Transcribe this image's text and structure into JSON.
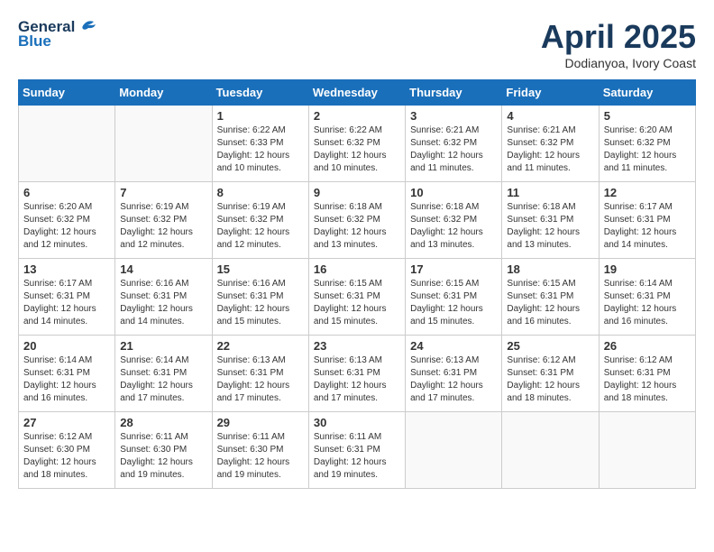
{
  "header": {
    "logo_general": "General",
    "logo_blue": "Blue",
    "title": "April 2025",
    "location": "Dodianyoa, Ivory Coast"
  },
  "weekdays": [
    "Sunday",
    "Monday",
    "Tuesday",
    "Wednesday",
    "Thursday",
    "Friday",
    "Saturday"
  ],
  "weeks": [
    [
      {
        "day": "",
        "sunrise": "",
        "sunset": "",
        "daylight": ""
      },
      {
        "day": "",
        "sunrise": "",
        "sunset": "",
        "daylight": ""
      },
      {
        "day": "1",
        "sunrise": "Sunrise: 6:22 AM",
        "sunset": "Sunset: 6:33 PM",
        "daylight": "Daylight: 12 hours and 10 minutes."
      },
      {
        "day": "2",
        "sunrise": "Sunrise: 6:22 AM",
        "sunset": "Sunset: 6:32 PM",
        "daylight": "Daylight: 12 hours and 10 minutes."
      },
      {
        "day": "3",
        "sunrise": "Sunrise: 6:21 AM",
        "sunset": "Sunset: 6:32 PM",
        "daylight": "Daylight: 12 hours and 11 minutes."
      },
      {
        "day": "4",
        "sunrise": "Sunrise: 6:21 AM",
        "sunset": "Sunset: 6:32 PM",
        "daylight": "Daylight: 12 hours and 11 minutes."
      },
      {
        "day": "5",
        "sunrise": "Sunrise: 6:20 AM",
        "sunset": "Sunset: 6:32 PM",
        "daylight": "Daylight: 12 hours and 11 minutes."
      }
    ],
    [
      {
        "day": "6",
        "sunrise": "Sunrise: 6:20 AM",
        "sunset": "Sunset: 6:32 PM",
        "daylight": "Daylight: 12 hours and 12 minutes."
      },
      {
        "day": "7",
        "sunrise": "Sunrise: 6:19 AM",
        "sunset": "Sunset: 6:32 PM",
        "daylight": "Daylight: 12 hours and 12 minutes."
      },
      {
        "day": "8",
        "sunrise": "Sunrise: 6:19 AM",
        "sunset": "Sunset: 6:32 PM",
        "daylight": "Daylight: 12 hours and 12 minutes."
      },
      {
        "day": "9",
        "sunrise": "Sunrise: 6:18 AM",
        "sunset": "Sunset: 6:32 PM",
        "daylight": "Daylight: 12 hours and 13 minutes."
      },
      {
        "day": "10",
        "sunrise": "Sunrise: 6:18 AM",
        "sunset": "Sunset: 6:32 PM",
        "daylight": "Daylight: 12 hours and 13 minutes."
      },
      {
        "day": "11",
        "sunrise": "Sunrise: 6:18 AM",
        "sunset": "Sunset: 6:31 PM",
        "daylight": "Daylight: 12 hours and 13 minutes."
      },
      {
        "day": "12",
        "sunrise": "Sunrise: 6:17 AM",
        "sunset": "Sunset: 6:31 PM",
        "daylight": "Daylight: 12 hours and 14 minutes."
      }
    ],
    [
      {
        "day": "13",
        "sunrise": "Sunrise: 6:17 AM",
        "sunset": "Sunset: 6:31 PM",
        "daylight": "Daylight: 12 hours and 14 minutes."
      },
      {
        "day": "14",
        "sunrise": "Sunrise: 6:16 AM",
        "sunset": "Sunset: 6:31 PM",
        "daylight": "Daylight: 12 hours and 14 minutes."
      },
      {
        "day": "15",
        "sunrise": "Sunrise: 6:16 AM",
        "sunset": "Sunset: 6:31 PM",
        "daylight": "Daylight: 12 hours and 15 minutes."
      },
      {
        "day": "16",
        "sunrise": "Sunrise: 6:15 AM",
        "sunset": "Sunset: 6:31 PM",
        "daylight": "Daylight: 12 hours and 15 minutes."
      },
      {
        "day": "17",
        "sunrise": "Sunrise: 6:15 AM",
        "sunset": "Sunset: 6:31 PM",
        "daylight": "Daylight: 12 hours and 15 minutes."
      },
      {
        "day": "18",
        "sunrise": "Sunrise: 6:15 AM",
        "sunset": "Sunset: 6:31 PM",
        "daylight": "Daylight: 12 hours and 16 minutes."
      },
      {
        "day": "19",
        "sunrise": "Sunrise: 6:14 AM",
        "sunset": "Sunset: 6:31 PM",
        "daylight": "Daylight: 12 hours and 16 minutes."
      }
    ],
    [
      {
        "day": "20",
        "sunrise": "Sunrise: 6:14 AM",
        "sunset": "Sunset: 6:31 PM",
        "daylight": "Daylight: 12 hours and 16 minutes."
      },
      {
        "day": "21",
        "sunrise": "Sunrise: 6:14 AM",
        "sunset": "Sunset: 6:31 PM",
        "daylight": "Daylight: 12 hours and 17 minutes."
      },
      {
        "day": "22",
        "sunrise": "Sunrise: 6:13 AM",
        "sunset": "Sunset: 6:31 PM",
        "daylight": "Daylight: 12 hours and 17 minutes."
      },
      {
        "day": "23",
        "sunrise": "Sunrise: 6:13 AM",
        "sunset": "Sunset: 6:31 PM",
        "daylight": "Daylight: 12 hours and 17 minutes."
      },
      {
        "day": "24",
        "sunrise": "Sunrise: 6:13 AM",
        "sunset": "Sunset: 6:31 PM",
        "daylight": "Daylight: 12 hours and 17 minutes."
      },
      {
        "day": "25",
        "sunrise": "Sunrise: 6:12 AM",
        "sunset": "Sunset: 6:31 PM",
        "daylight": "Daylight: 12 hours and 18 minutes."
      },
      {
        "day": "26",
        "sunrise": "Sunrise: 6:12 AM",
        "sunset": "Sunset: 6:31 PM",
        "daylight": "Daylight: 12 hours and 18 minutes."
      }
    ],
    [
      {
        "day": "27",
        "sunrise": "Sunrise: 6:12 AM",
        "sunset": "Sunset: 6:30 PM",
        "daylight": "Daylight: 12 hours and 18 minutes."
      },
      {
        "day": "28",
        "sunrise": "Sunrise: 6:11 AM",
        "sunset": "Sunset: 6:30 PM",
        "daylight": "Daylight: 12 hours and 19 minutes."
      },
      {
        "day": "29",
        "sunrise": "Sunrise: 6:11 AM",
        "sunset": "Sunset: 6:30 PM",
        "daylight": "Daylight: 12 hours and 19 minutes."
      },
      {
        "day": "30",
        "sunrise": "Sunrise: 6:11 AM",
        "sunset": "Sunset: 6:31 PM",
        "daylight": "Daylight: 12 hours and 19 minutes."
      },
      {
        "day": "",
        "sunrise": "",
        "sunset": "",
        "daylight": ""
      },
      {
        "day": "",
        "sunrise": "",
        "sunset": "",
        "daylight": ""
      },
      {
        "day": "",
        "sunrise": "",
        "sunset": "",
        "daylight": ""
      }
    ]
  ]
}
